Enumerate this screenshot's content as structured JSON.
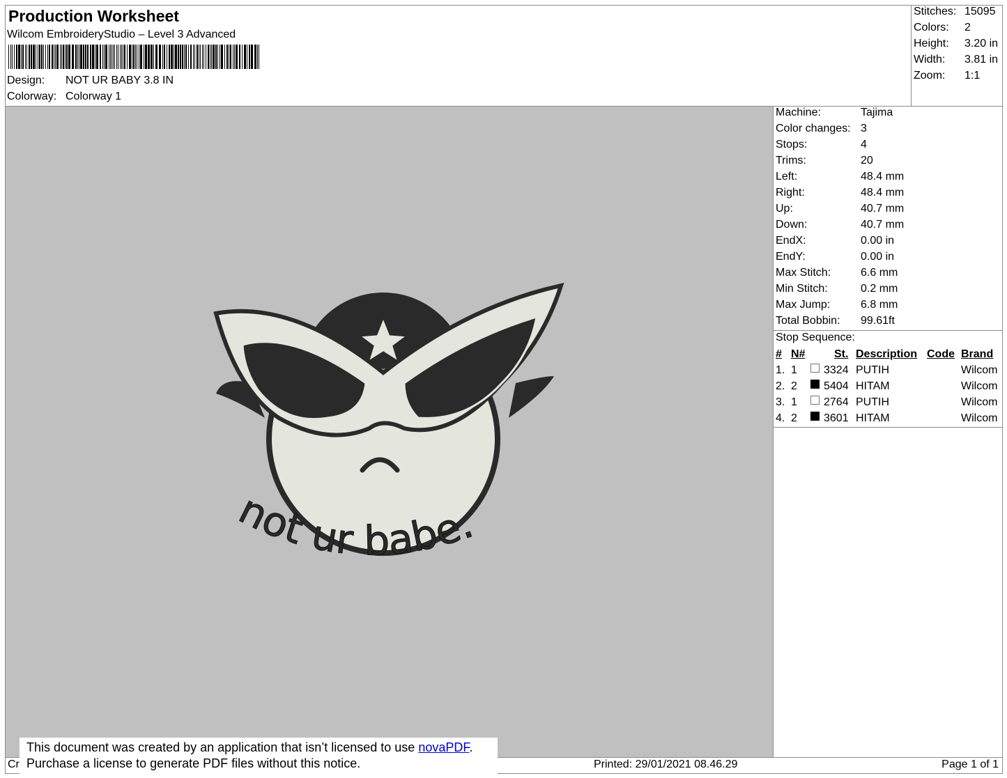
{
  "header": {
    "title": "Production Worksheet",
    "software": "Wilcom EmbroideryStudio – Level 3 Advanced",
    "design_label": "Design:",
    "design_value": "NOT UR BABY 3.8 IN",
    "colorway_label": "Colorway:",
    "colorway_value": "Colorway 1"
  },
  "summary": [
    {
      "label": "Stitches:",
      "value": "15095"
    },
    {
      "label": "Colors:",
      "value": "2"
    },
    {
      "label": "Height:",
      "value": "3.20 in"
    },
    {
      "label": "Width:",
      "value": "3.81 in"
    },
    {
      "label": "Zoom:",
      "value": "1:1"
    }
  ],
  "machine_info": [
    {
      "label": "Machine:",
      "value": "Tajima"
    },
    {
      "label": "Color changes:",
      "value": "3"
    },
    {
      "label": "Stops:",
      "value": "4"
    },
    {
      "label": "Trims:",
      "value": "20"
    },
    {
      "label": "Left:",
      "value": "48.4 mm"
    },
    {
      "label": "Right:",
      "value": "48.4 mm"
    },
    {
      "label": "Up:",
      "value": "40.7 mm"
    },
    {
      "label": "Down:",
      "value": "40.7 mm"
    },
    {
      "label": "EndX:",
      "value": "0.00 in"
    },
    {
      "label": "EndY:",
      "value": "0.00 in"
    },
    {
      "label": "Max Stitch:",
      "value": "6.6 mm"
    },
    {
      "label": "Min Stitch:",
      "value": "0.2 mm"
    },
    {
      "label": "Max Jump:",
      "value": "6.8 mm"
    },
    {
      "label": "Total Bobbin:",
      "value": "99.61ft"
    }
  ],
  "stop_sequence": {
    "title": "Stop Sequence:",
    "headers": [
      "#",
      "N#",
      "St.",
      "Description",
      "Code",
      "Brand"
    ],
    "rows": [
      {
        "idx": "1.",
        "n": "1",
        "color": "white",
        "st": "3324",
        "desc": "PUTIH",
        "code": "",
        "brand": "Wilcom"
      },
      {
        "idx": "2.",
        "n": "2",
        "color": "black",
        "st": "5404",
        "desc": "HITAM",
        "code": "",
        "brand": "Wilcom"
      },
      {
        "idx": "3.",
        "n": "1",
        "color": "white",
        "st": "2764",
        "desc": "PUTIH",
        "code": "",
        "brand": "Wilcom"
      },
      {
        "idx": "4.",
        "n": "2",
        "color": "black",
        "st": "3601",
        "desc": "HITAM",
        "code": "",
        "brand": "Wilcom"
      }
    ]
  },
  "artwork": {
    "text": "not ur babe."
  },
  "notice": {
    "line1_prefix": "This document was created by an application that isn’t licensed to use ",
    "link": "novaPDF",
    "line1_suffix": ".",
    "line2": "Purchase a license to generate PDF files without this notice."
  },
  "footer": {
    "left": "Cr",
    "printed": "Printed: 29/01/2021 08.46.29",
    "page": "Page 1 of 1"
  },
  "colors": {
    "preview_bg": "#c0c0c0",
    "thread_white": "#e4e6de",
    "thread_black": "#2a2a2a"
  }
}
